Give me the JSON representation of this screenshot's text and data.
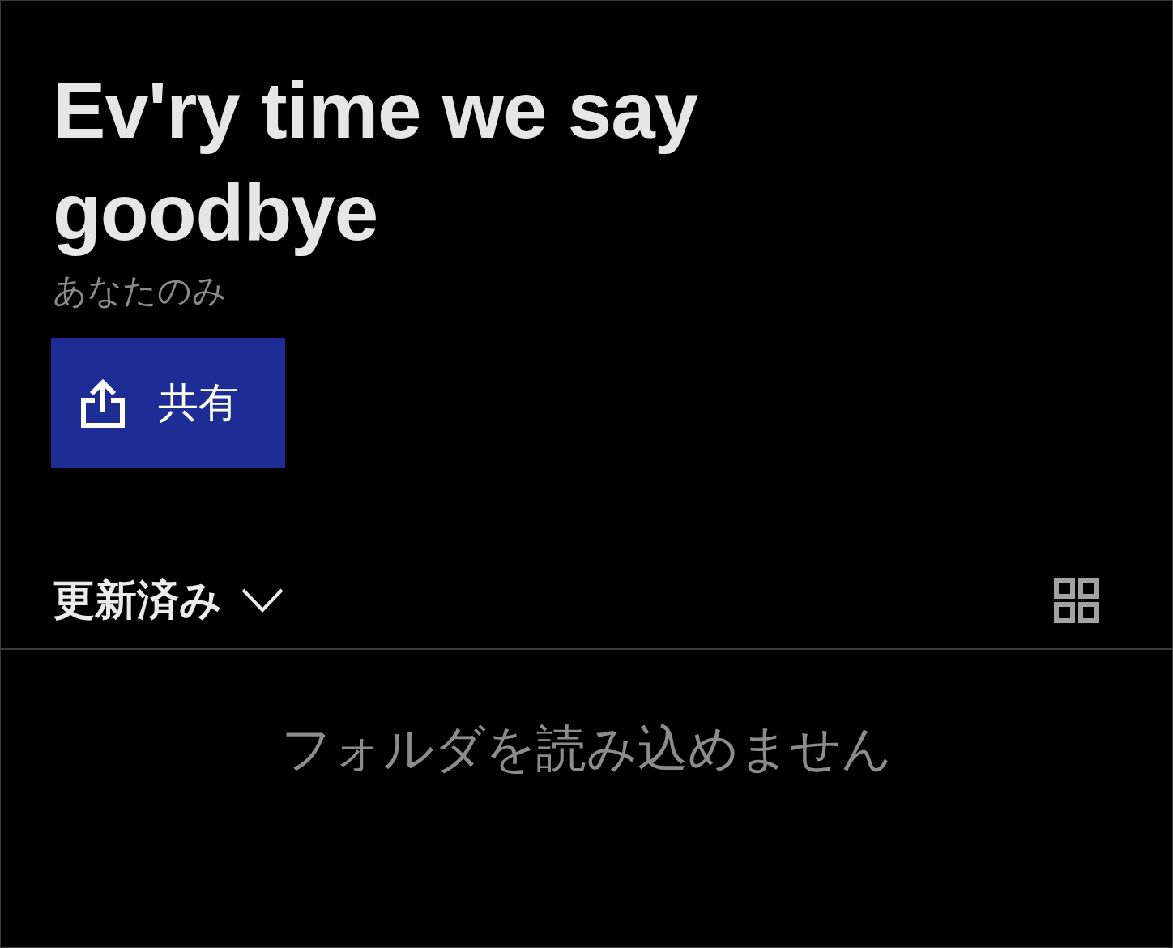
{
  "header": {
    "title": "Ev'ry time we say goodbye",
    "subtitle": "あなたのみ"
  },
  "share_button": {
    "label": "共有"
  },
  "sort": {
    "label": "更新済み"
  },
  "empty_message": "フォルダを読み込めません"
}
